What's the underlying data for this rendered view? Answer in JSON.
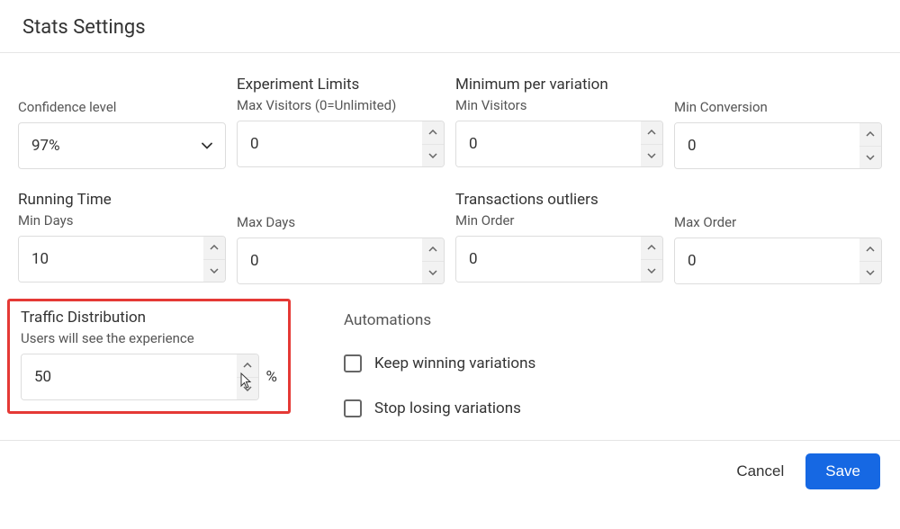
{
  "header": {
    "title": "Stats Settings"
  },
  "confidence": {
    "label": "Confidence level",
    "value": "97%"
  },
  "experiment_limits": {
    "title": "Experiment Limits",
    "max_visitors_label": "Max Visitors (0=Unlimited)",
    "max_visitors_value": "0"
  },
  "min_per_variation": {
    "title": "Minimum per variation",
    "min_visitors_label": "Min Visitors",
    "min_visitors_value": "0",
    "min_conversion_label": "Min Conversion",
    "min_conversion_value": "0"
  },
  "running_time": {
    "title": "Running Time",
    "min_days_label": "Min Days",
    "min_days_value": "10",
    "max_days_label": "Max Days",
    "max_days_value": "0"
  },
  "transactions_outliers": {
    "title": "Transactions outliers",
    "min_order_label": "Min Order",
    "min_order_value": "0",
    "max_order_label": "Max Order",
    "max_order_value": "0"
  },
  "traffic": {
    "title": "Traffic Distribution",
    "subtitle": "Users will see the experience",
    "value": "50",
    "unit": "%"
  },
  "automations": {
    "title": "Automations",
    "keep_winning": "Keep winning variations",
    "stop_losing": "Stop losing variations"
  },
  "footer": {
    "cancel": "Cancel",
    "save": "Save"
  }
}
